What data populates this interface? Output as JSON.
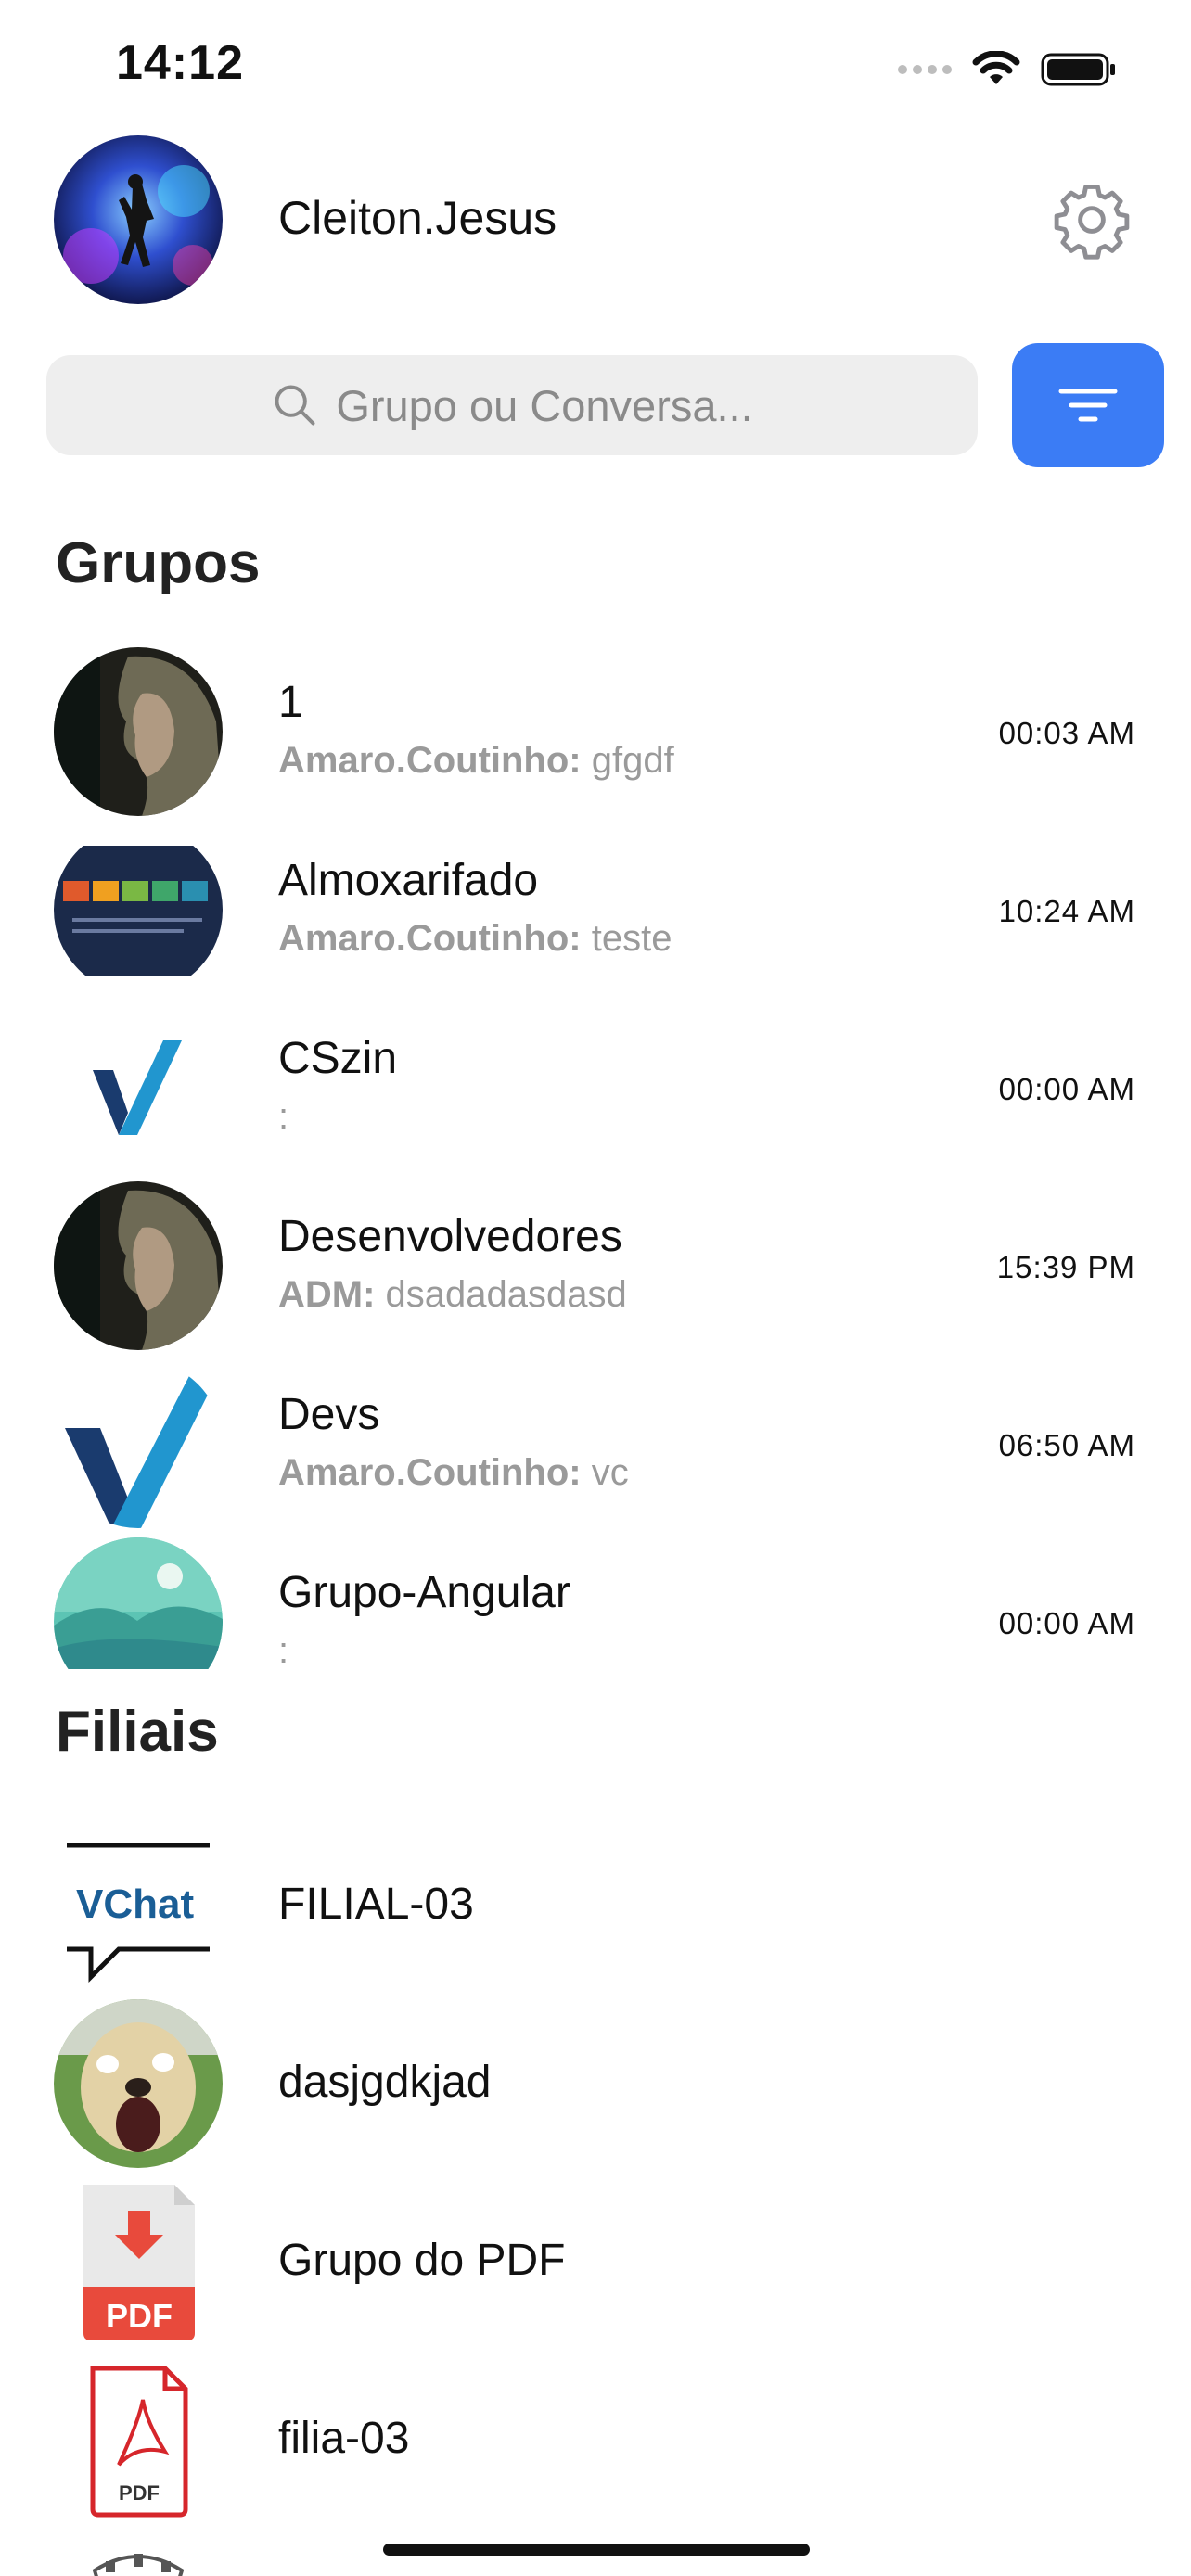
{
  "status_bar": {
    "time": "14:12"
  },
  "profile": {
    "name": "Cleiton.Jesus"
  },
  "search": {
    "placeholder": "Grupo ou Conversa..."
  },
  "sections": {
    "groups_title": "Grupos",
    "branches_title": "Filiais"
  },
  "groups": [
    {
      "name": "1",
      "sender": "Amaro.Coutinho:",
      "message": "gfgdf",
      "time": "00:03 AM",
      "avatar_icon": "hooded-man-photo-icon"
    },
    {
      "name": "Almoxarifado",
      "sender": "Amaro.Coutinho:",
      "message": "teste",
      "time": "10:24 AM",
      "avatar_icon": "presentation-slide-photo-icon"
    },
    {
      "name": "CSzin",
      "sender": "",
      "message": ":",
      "time": "00:00 AM",
      "avatar_icon": "v-logo-icon"
    },
    {
      "name": "Desenvolvedores",
      "sender": "ADM:",
      "message": "dsadadasdasd",
      "time": "15:39 PM",
      "avatar_icon": "hooded-man-photo-icon"
    },
    {
      "name": "Devs",
      "sender": "Amaro.Coutinho:",
      "message": "vc",
      "time": "06:50 AM",
      "avatar_icon": "v-logo-icon"
    },
    {
      "name": "Grupo-Angular",
      "sender": "",
      "message": ":",
      "time": "00:00 AM",
      "avatar_icon": "landscape-illustration-icon"
    }
  ],
  "branches": [
    {
      "name": "FILIAL-03",
      "avatar_icon": "vchat-logo-icon",
      "logo_text": "VChat"
    },
    {
      "name": "dasjgdkjad",
      "avatar_icon": "dog-photo-icon"
    },
    {
      "name": "Grupo do PDF",
      "avatar_icon": "pdf-download-icon",
      "logo_text": "PDF"
    },
    {
      "name": "filia-03",
      "avatar_icon": "pdf-file-icon",
      "logo_text": "PDF"
    }
  ],
  "colors": {
    "accent": "#3b7cf5",
    "muted_text": "#9a9a9a",
    "search_bg": "#eeeeee"
  }
}
